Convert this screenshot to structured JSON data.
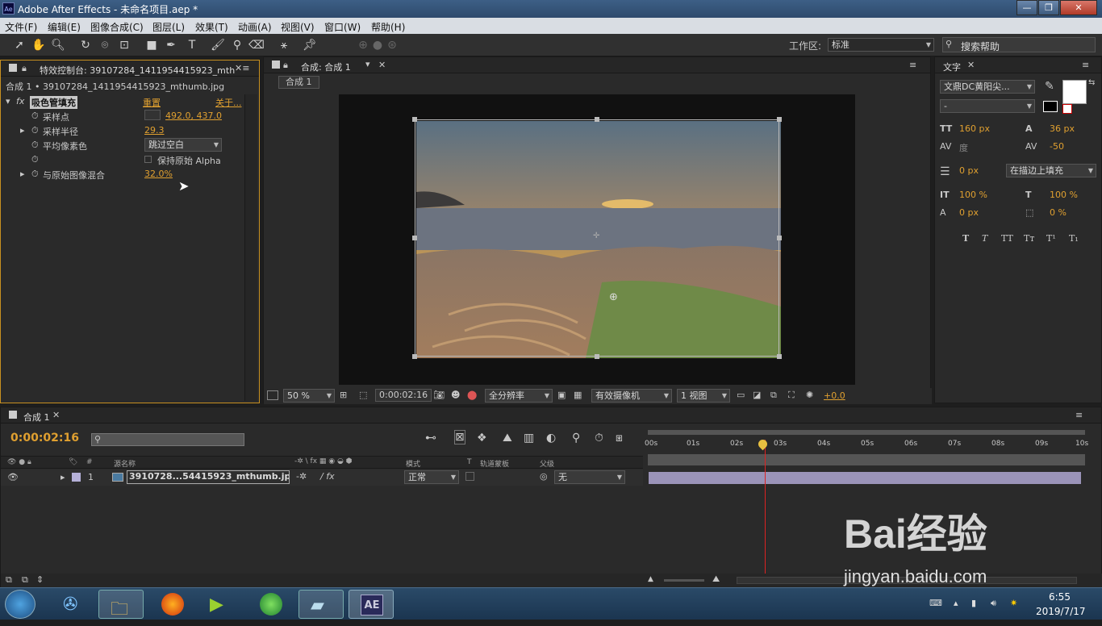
{
  "window": {
    "title": "Adobe After Effects - 未命名项目.aep *",
    "icon_label": "Ae"
  },
  "window_buttons": {
    "minimize": "—",
    "maximize": "❐",
    "close": "✕"
  },
  "menu": [
    "文件(F)",
    "编辑(E)",
    "图像合成(C)",
    "图层(L)",
    "效果(T)",
    "动画(A)",
    "视图(V)",
    "窗口(W)",
    "帮助(H)"
  ],
  "toolbar": {
    "workspace_label": "工作区:",
    "workspace_value": "标准",
    "search_placeholder": "搜索帮助"
  },
  "effects_panel": {
    "tab": "特效控制台: 39107284_1411954415923_mth",
    "breadcrumb": "合成 1 • 39107284_1411954415923_mthumb.jpg",
    "effect_name": "吸色管填充",
    "reset": "重置",
    "about": "关于...",
    "props": [
      {
        "name": "采样点",
        "value": "492.0, 437.0"
      },
      {
        "name": "采样半径",
        "value": "29.3"
      },
      {
        "name": "平均像素色",
        "value": "跳过空白"
      },
      {
        "name": "",
        "value": "保持原始 Alpha"
      },
      {
        "name": "与原始图像混合",
        "value": "32.0%"
      }
    ]
  },
  "comp_panel": {
    "tab": "合成: 合成 1",
    "sub_tab": "合成 1",
    "zoom": "50 %",
    "timecode": "0:00:02:16",
    "resolution": "全分辨率",
    "camera": "有效摄像机",
    "views": "1 视图",
    "exposure": "+0.0"
  },
  "text_panel": {
    "tab": "文字",
    "font": "文鼎DC黄阳尖...",
    "style": "-",
    "size": "160 px",
    "leading": "36 px",
    "kerning": "度",
    "tracking": "-50",
    "stroke_width": "0 px",
    "stroke_mode": "在描边上填充",
    "vscale": "100 %",
    "hscale": "100 %",
    "baseline": "0 px",
    "tsume": "0 %",
    "styles": [
      "T",
      "T",
      "TT",
      "Tт",
      "T¹",
      "T₁"
    ]
  },
  "timeline": {
    "tab": "合成 1",
    "timecode": "0:00:02:16",
    "search_placeholder": "",
    "columns": {
      "num": "#",
      "source": "源名称",
      "mode": "模式",
      "t": "T",
      "trkmat": "轨道蒙板",
      "parent": "父级"
    },
    "layer": {
      "num": "1",
      "name": "3910728...54415923_mthumb.jpg",
      "mode": "正常",
      "parent": "无"
    },
    "ruler": [
      "00s",
      "01s",
      "02s",
      "03s",
      "04s",
      "05s",
      "06s",
      "07s",
      "08s",
      "09s",
      "10s"
    ],
    "playhead_seconds": 2.7
  },
  "taskbar": {
    "time": "6:55",
    "date": "2019/7/17",
    "ae_label": "AE"
  },
  "watermark": {
    "brand": "Bai经验",
    "url": "jingyan.baidu.com"
  }
}
